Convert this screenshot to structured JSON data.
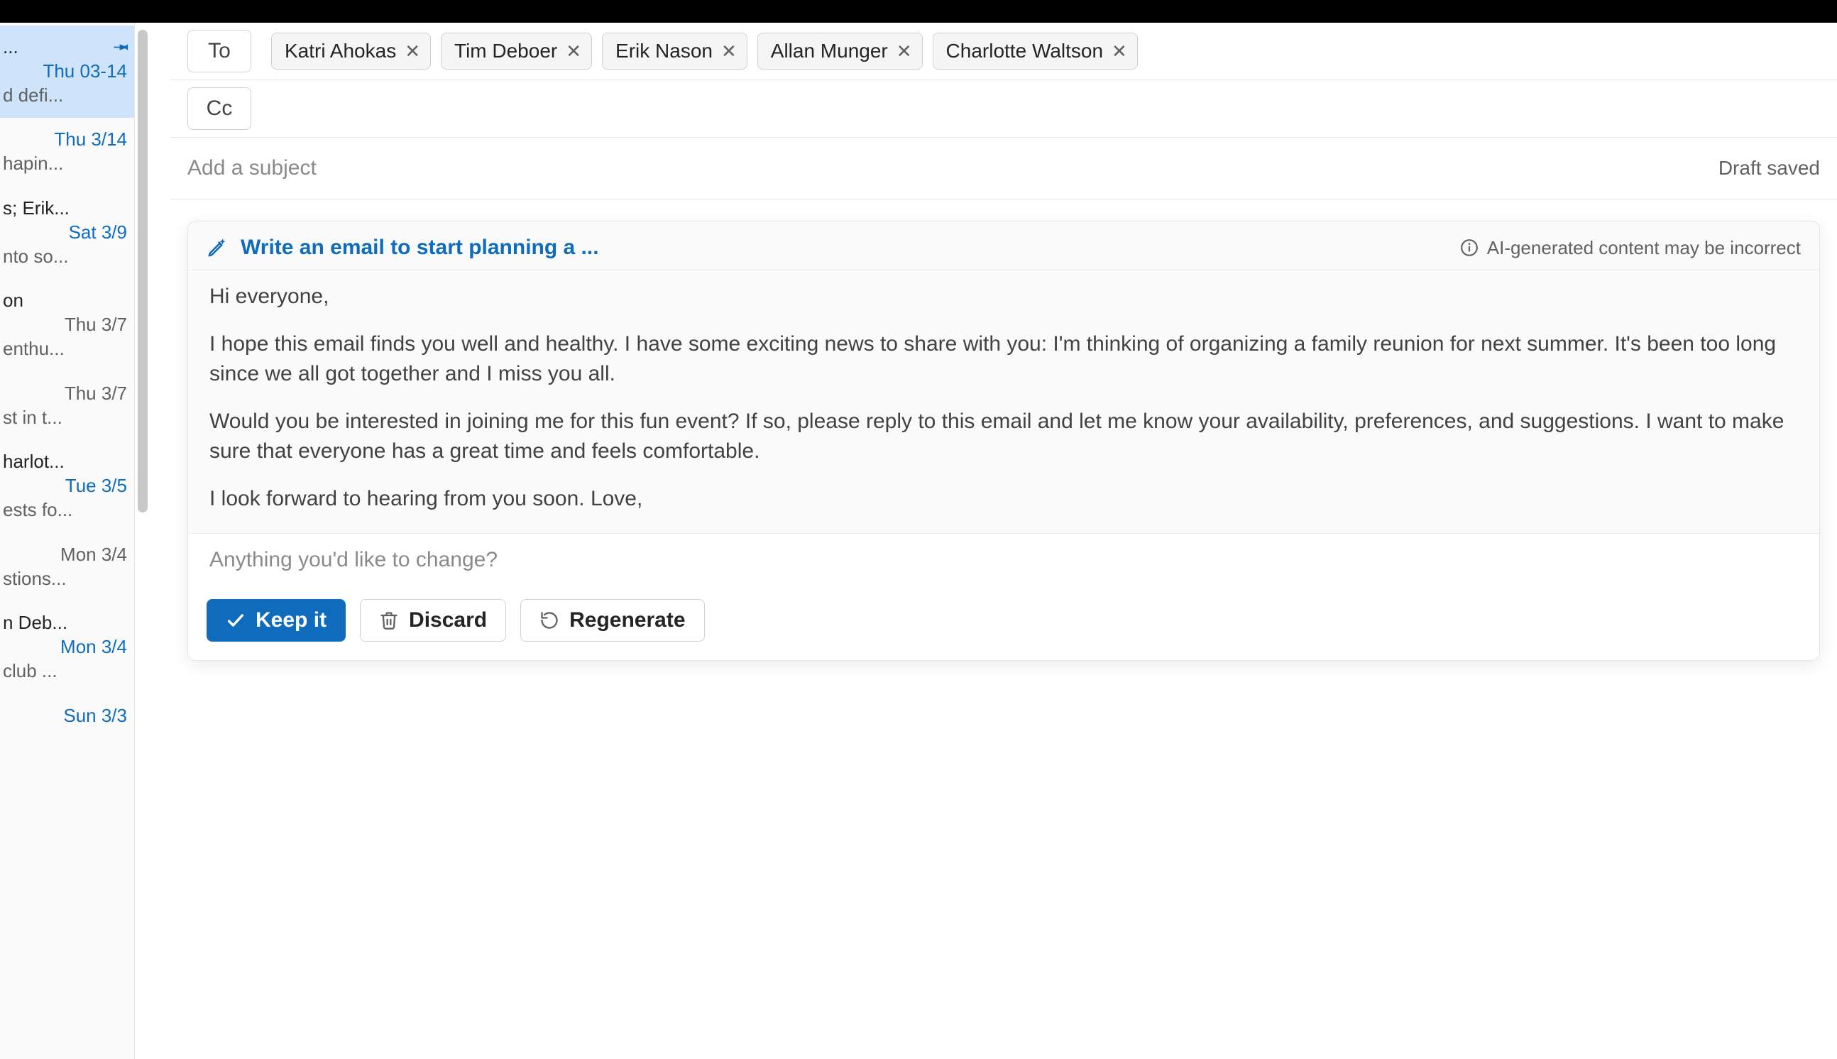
{
  "rail": {
    "items": [
      {
        "line1": "...",
        "date": "Thu 03-14",
        "date_gray": false,
        "snippet": "d defi...",
        "selected": true,
        "pinned": true
      },
      {
        "line1": "",
        "date": "Thu 3/14",
        "date_gray": false,
        "snippet": "hapin...",
        "selected": false,
        "pinned": false
      },
      {
        "line1": "s; Erik...",
        "date": "Sat 3/9",
        "date_gray": false,
        "snippet": "nto so...",
        "selected": false,
        "pinned": false
      },
      {
        "line1": "on",
        "date": "Thu 3/7",
        "date_gray": true,
        "snippet": "enthu...",
        "selected": false,
        "pinned": false
      },
      {
        "line1": "",
        "date": "Thu 3/7",
        "date_gray": true,
        "snippet": "st in t...",
        "selected": false,
        "pinned": false
      },
      {
        "line1": "harlot...",
        "date": "Tue 3/5",
        "date_gray": false,
        "snippet": "ests fo...",
        "selected": false,
        "pinned": false
      },
      {
        "line1": "",
        "date": "Mon 3/4",
        "date_gray": true,
        "snippet": "stions...",
        "selected": false,
        "pinned": false
      },
      {
        "line1": "n Deb...",
        "date": "Mon 3/4",
        "date_gray": false,
        "snippet": "club ...",
        "selected": false,
        "pinned": false
      },
      {
        "line1": "",
        "date": "Sun 3/3",
        "date_gray": false,
        "snippet": "",
        "selected": false,
        "pinned": false
      }
    ]
  },
  "compose": {
    "to_label": "To",
    "cc_label": "Cc",
    "recipients": [
      "Katri Ahokas",
      "Tim Deboer",
      "Erik Nason",
      "Allan Munger",
      "Charlotte Waltson"
    ],
    "subject_placeholder": "Add a subject",
    "draft_status": "Draft saved"
  },
  "ai": {
    "prompt": "Write an email to start planning a ...",
    "disclaimer": "AI-generated content may be incorrect",
    "body": {
      "p1": "Hi everyone,",
      "p2": "I hope this email finds you well and healthy. I have some exciting news to share with you: I'm thinking of organizing a family reunion for next summer. It's been too long since we all got together and I miss you all.",
      "p3": "Would you be interested in joining me for this fun event? If so, please reply to this email and let me know your availability, preferences, and suggestions. I want to make sure that everyone has a great time and feels comfortable.",
      "p4": "I look forward to hearing from you soon. Love,"
    },
    "refine_placeholder": "Anything you'd like to change?",
    "keep_label": "Keep it",
    "discard_label": "Discard",
    "regenerate_label": "Regenerate"
  }
}
